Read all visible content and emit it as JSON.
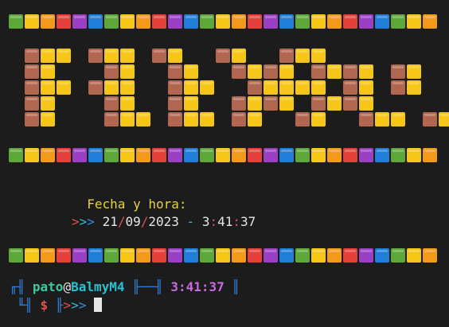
{
  "colors": {
    "background": "#1c1c1c",
    "palette": [
      "#5ea83a",
      "#f5c518",
      "#f39a1b",
      "#e5403a",
      "#9b3fc5",
      "#1f7fd8",
      "#5ea83a",
      "#f5c518",
      "#f39a1b",
      "#e5403a",
      "#9b3fc5",
      "#1f7fd8"
    ],
    "banner_dark": "#b0664f",
    "banner_light": "#f5c518",
    "yellow_text": "#e8d13a",
    "white_text": "#e6e6e6",
    "red": "#e05050",
    "cyan": "#29c0d0",
    "blue": "#2f8fe0",
    "green": "#3cc9a0",
    "magenta": "#c66be0",
    "frame": "#2f7fd8",
    "cursor": "#e6e6e6"
  },
  "banner": {
    "text": "FECHA:",
    "rows": [
      "bll.bll.bl..bl..bll.......",
      "bl...bl..bl..blbl.blbl.bl.",
      "bll.bll..bll..bllll.bl.bl.",
      "bl...bl..bl..blbl.blbl....",
      "bl...bll.bll.bl..bl..bll.bl"
    ]
  },
  "heading": {
    "text": "Fecha y hora:"
  },
  "datetime": {
    "arrows": ">>>",
    "day": "21",
    "sep1": "/",
    "month": "09",
    "sep2": "/",
    "year": "2023",
    "dash": "-",
    "hour": "3",
    "colon1": ":",
    "minute": "41",
    "colon2": ":",
    "second": "37"
  },
  "prompt": {
    "user": "pato",
    "at": "@",
    "host": "BalmyM4",
    "time": "3:41:37",
    "symbol": "$",
    "arrows": ">>>"
  }
}
